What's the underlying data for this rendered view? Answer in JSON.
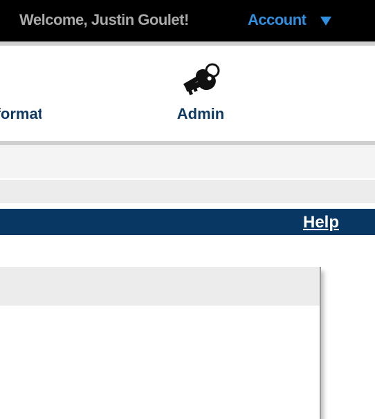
{
  "header": {
    "welcome_text": "Welcome, Justin Goulet!",
    "account_label": "Account"
  },
  "nav": {
    "partial_item_label": "Information",
    "admin_label": "Admin",
    "admin_icon": "keys-icon"
  },
  "bluebar": {
    "help_label": "Help"
  },
  "colors": {
    "topbar_bg": "#000000",
    "welcome_text": "#a9a9a9",
    "account_text": "#2f8fe0",
    "nav_text": "#0e3a63",
    "bluebar_bg": "#083763"
  }
}
